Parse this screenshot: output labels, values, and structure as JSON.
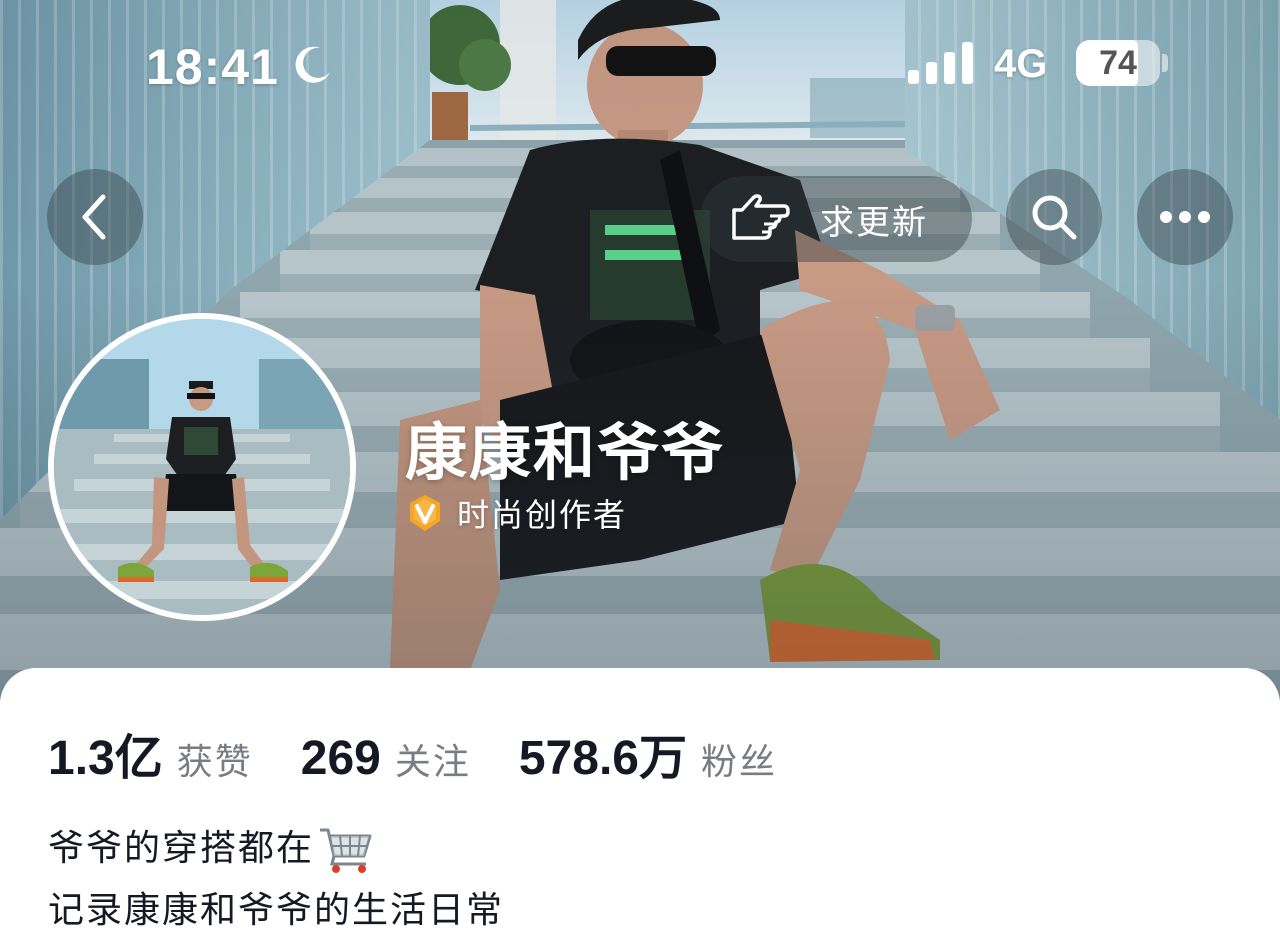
{
  "status_bar": {
    "time": "18:41",
    "network": "4G",
    "battery_level": 74,
    "battery_label": "74",
    "icons": [
      "moon-icon",
      "signal-icon",
      "battery-icon"
    ]
  },
  "nav": {
    "back_icon": "chevron-left-icon",
    "update_request_label": "求更新",
    "update_request_icon": "pointing-hand-icon",
    "search_icon": "search-icon",
    "more_icon": "more-dots-icon"
  },
  "profile": {
    "name": "康康和爷爷",
    "verification_label": "时尚创作者",
    "verification_icon": "verified-v-badge-icon",
    "verification_color": "#F5A623"
  },
  "stats": [
    {
      "value": "1.3亿",
      "label": "获赞"
    },
    {
      "value": "269",
      "label": "关注"
    },
    {
      "value": "578.6万",
      "label": "粉丝"
    }
  ],
  "bio": {
    "line1": "爷爷的穿搭都在",
    "line1_icon": "shopping-cart-icon",
    "line2": "记录康康和爷爷的生活日常"
  },
  "colors": {
    "primary_text": "#161823",
    "secondary_text": "#7a7c84",
    "card_background": "#ffffff"
  }
}
